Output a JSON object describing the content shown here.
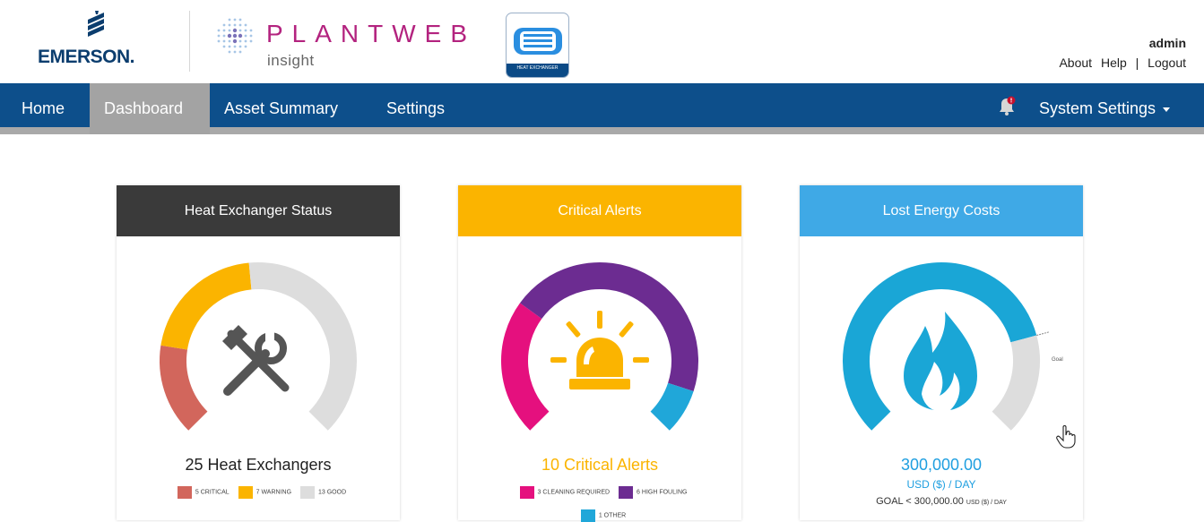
{
  "brand": {
    "emerson": "EMERSON.",
    "plantweb": "PLANTWEB",
    "plantweb_sub": "insight",
    "badge_label": "HEAT EXCHANGER"
  },
  "user": {
    "name": "admin",
    "links": [
      "About",
      "Help",
      "|",
      "Logout"
    ]
  },
  "nav": {
    "items": [
      "Home",
      "Dashboard",
      "Asset Summary",
      "Settings"
    ],
    "active": "Dashboard",
    "system_settings": "System Settings"
  },
  "colors": {
    "nav_bg": "#0d4f8b",
    "active_tab": "#a3a3a3",
    "critical": "#d2665c",
    "warning": "#fbb400",
    "good": "#dddddd",
    "cleaning": "#e5107e",
    "fouling": "#6c2c91",
    "other": "#20a7d9",
    "energy": "#1aa6d6",
    "status_head": "#3a3a3a",
    "alerts_head": "#fbb400",
    "energy_head": "#3fa9e6"
  },
  "cards": {
    "status": {
      "title": "Heat Exchanger Status",
      "summary": "25 Heat Exchangers",
      "icon": "tools-icon",
      "legend": [
        {
          "count": "5",
          "label": "CRITICAL"
        },
        {
          "count": "7",
          "label": "WARNING"
        },
        {
          "count": "13",
          "label": "GOOD"
        }
      ]
    },
    "alerts": {
      "title": "Critical Alerts",
      "summary": "10 Critical Alerts",
      "icon": "alarm-light-icon",
      "legend": [
        {
          "count": "3",
          "label": "CLEANING REQUIRED"
        },
        {
          "count": "6",
          "label": "HIGH FOULING"
        },
        {
          "count": "1",
          "label": "OTHER"
        }
      ]
    },
    "energy": {
      "title": "Lost Energy Costs",
      "value": "300,000.00",
      "unit": "USD ($) / DAY",
      "goal_prefix": "GOAL < 300,000.00",
      "goal_unit": "USD ($) / DAY",
      "goal_marker": "Goal",
      "icon": "flame-icon"
    }
  }
}
